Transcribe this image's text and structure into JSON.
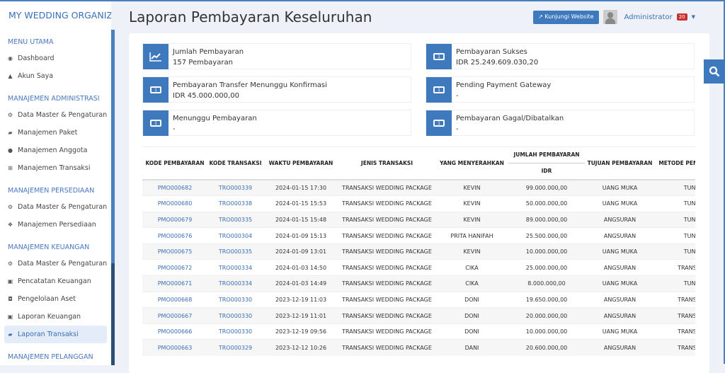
{
  "brand": "MY WEDDING ORGANIZER",
  "sidebar": [
    {
      "section": "MENU UTAMA",
      "items": [
        {
          "icon": "globe-icon",
          "g": "◉",
          "label": "Dashboard"
        },
        {
          "icon": "user-icon",
          "g": "▲",
          "label": "Akun Saya"
        }
      ]
    },
    {
      "section": "MANAJEMEN ADMINISTRASI",
      "items": [
        {
          "icon": "cogs-icon",
          "g": "⚙",
          "label": "Data Master & Pengaturan"
        },
        {
          "icon": "book-icon",
          "g": "▰",
          "label": "Manajemen Paket"
        },
        {
          "icon": "users-icon",
          "g": "●",
          "label": "Manajemen Anggota"
        },
        {
          "icon": "cart-icon",
          "g": "⊞",
          "label": "Manajemen Transaksi"
        }
      ]
    },
    {
      "section": "MANAJEMEN PERSEDIAAN",
      "items": [
        {
          "icon": "cogs-icon",
          "g": "⚙",
          "label": "Data Master & Pengaturan"
        },
        {
          "icon": "cubes-icon",
          "g": "❖",
          "label": "Manajemen Persediaan"
        }
      ]
    },
    {
      "section": "MANAJEMEN KEUANGAN",
      "items": [
        {
          "icon": "cogs-icon",
          "g": "⚙",
          "label": "Data Master & Pengaturan"
        },
        {
          "icon": "money-icon",
          "g": "▣",
          "label": "Pencatatan Keuangan"
        },
        {
          "icon": "inbox-icon",
          "g": "◘",
          "label": "Pengelolaan Aset"
        },
        {
          "icon": "money-icon",
          "g": "▣",
          "label": "Laporan Keuangan"
        },
        {
          "icon": "book-icon",
          "g": "▰",
          "label": "Laporan Transaksi",
          "active": true
        }
      ]
    },
    {
      "section": "MANAJEMEN PELANGGAN",
      "items": []
    }
  ],
  "header": {
    "title": "Laporan Pembayaran Keseluruhan",
    "visit_label": "Kunjungi Website",
    "user": "Administrator",
    "badge": "20"
  },
  "stats": [
    {
      "icon": "chart-line-icon",
      "label": "Jumlah Pembayaran",
      "value": "157 Pembayaran"
    },
    {
      "icon": "money-icon",
      "label": "Pembayaran Sukses",
      "value": "IDR 25.249.609.030,20"
    },
    {
      "icon": "money-icon",
      "label": "Pembayaran Transfer Menunggu Konfirmasi",
      "value": "IDR 45.000.000,00"
    },
    {
      "icon": "money-icon",
      "label": "Pending Payment Gateway",
      "value": "-"
    },
    {
      "icon": "money-icon",
      "label": "Menunggu Pembayaran",
      "value": "-"
    },
    {
      "icon": "money-icon",
      "label": "Pembayaran Gagal/Dibatalkan",
      "value": "-"
    }
  ],
  "table": {
    "headers": [
      "KODE PEMBAYARAN",
      "KODE TRANSAKSI",
      "WAKTU PEMBAYARAN",
      "JENIS TRANSAKSI",
      "YANG MENYERAHKAN",
      "JUMLAH PEMBAYARAN",
      "TUJUAN PEMBAYARAN",
      "METODE PEMBAYARAN"
    ],
    "subheader": "IDR",
    "rows": [
      [
        "PMO000682",
        "TRO000339",
        "2024-01-15 17:30",
        "TRANSAKSI WEDDING PACKAGE",
        "KEVIN",
        "99.000.000,00",
        "UANG MUKA",
        "TUNAI"
      ],
      [
        "PMO000680",
        "TRO000338",
        "2024-01-15 15:53",
        "TRANSAKSI WEDDING PACKAGE",
        "KEVIN",
        "50.000.000,00",
        "UANG MUKA",
        "TUNAI"
      ],
      [
        "PMO000679",
        "TRO000335",
        "2024-01-15 15:48",
        "TRANSAKSI WEDDING PACKAGE",
        "KEVIN",
        "89.000.000,00",
        "ANGSURAN",
        "TUNAI"
      ],
      [
        "PMO000676",
        "TRO000304",
        "2024-01-09 15:13",
        "TRANSAKSI WEDDING PACKAGE",
        "PRITA HANIFAH",
        "25.500.000,00",
        "ANGSURAN",
        "TUNAI"
      ],
      [
        "PMO000675",
        "TRO000335",
        "2024-01-09 13:01",
        "TRANSAKSI WEDDING PACKAGE",
        "KEVIN",
        "10.000.000,00",
        "UANG MUKA",
        "TUNAI"
      ],
      [
        "PMO000672",
        "TRO000334",
        "2024-01-03 14:50",
        "TRANSAKSI WEDDING PACKAGE",
        "CIKA",
        "25.000.000,00",
        "ANGSURAN",
        "TRANSFER"
      ],
      [
        "PMO000671",
        "TRO000334",
        "2024-01-03 14:49",
        "TRANSAKSI WEDDING PACKAGE",
        "CIKA",
        "8.000.000,00",
        "UANG MUKA",
        "TUNAI"
      ],
      [
        "PMO000668",
        "TRO000330",
        "2023-12-19 11:03",
        "TRANSAKSI WEDDING PACKAGE",
        "DONI",
        "19.650.000,00",
        "ANGSURAN",
        "TRANSFER"
      ],
      [
        "PMO000667",
        "TRO000330",
        "2023-12-19 11:01",
        "TRANSAKSI WEDDING PACKAGE",
        "DONI",
        "20.000.000,00",
        "ANGSURAN",
        "TRANSFER"
      ],
      [
        "PMO000666",
        "TRO000330",
        "2023-12-19 09:56",
        "TRANSAKSI WEDDING PACKAGE",
        "DONI",
        "10.000.000,00",
        "UANG MUKA",
        "TRANSFER"
      ],
      [
        "PMO000663",
        "TRO000329",
        "2023-12-12 10:26",
        "TRANSAKSI WEDDING PACKAGE",
        "DANI",
        "20.600.000,00",
        "ANGSURAN",
        "TRANSFER"
      ]
    ]
  }
}
